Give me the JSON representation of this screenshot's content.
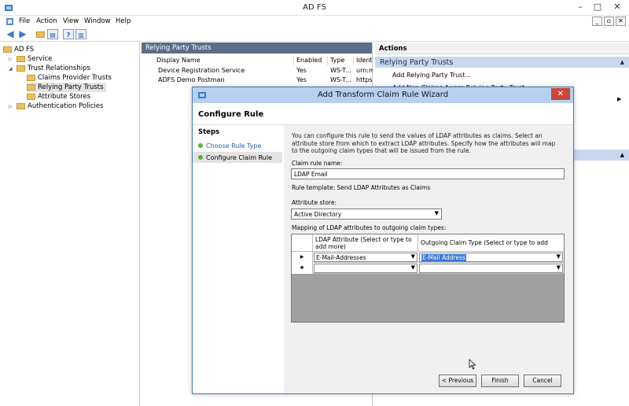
{
  "window": {
    "title": "AD FS",
    "controls": {
      "min": "–",
      "max": "□",
      "close": "✕"
    }
  },
  "menu": [
    "File",
    "Action",
    "View",
    "Window",
    "Help"
  ],
  "menu_sub_buttons": [
    "_",
    "▫",
    "✕"
  ],
  "tree": {
    "root": "AD FS",
    "items": [
      {
        "label": "Service"
      },
      {
        "label": "Trust Relationships"
      },
      {
        "label": "Claims Provider Trusts"
      },
      {
        "label": "Relying Party Trusts"
      },
      {
        "label": "Attribute Stores"
      },
      {
        "label": "Authentication Policies"
      }
    ]
  },
  "middle": {
    "header": "Relying Party Trusts",
    "columns": [
      "Display Name",
      "Enabled",
      "Type",
      "Identifi"
    ],
    "rows": [
      [
        "Device Registration Service",
        "Yes",
        "WS-T...",
        "urn:ms"
      ],
      [
        "ADFS Demo Postman",
        "Yes",
        "WS-T...",
        "https:/"
      ]
    ]
  },
  "actions": {
    "header": "Actions",
    "section": "Relying Party Trusts",
    "items": [
      "Add Relying Party Trust...",
      "Add Non-Claims-Aware Relying Party Trust..."
    ]
  },
  "dialog": {
    "title": "Add Transform Claim Rule Wizard",
    "heading": "Configure Rule",
    "steps_title": "Steps",
    "steps": [
      "Choose Rule Type",
      "Configure Claim Rule"
    ],
    "description": "You can configure this rule to send the values of LDAP attributes as claims. Select an attribute store from which to extract LDAP attributes. Specify how the attributes will map to the outgoing claim types that will be issued from the rule.",
    "claim_rule_name_label": "Claim rule name:",
    "claim_rule_name_value": "LDAP Email",
    "rule_template": "Rule template: Send LDAP Attributes as Claims",
    "attribute_store_label": "Attribute store:",
    "attribute_store_value": "Active Directory",
    "mapping_label": "Mapping of LDAP attributes to outgoing claim types:",
    "grid": {
      "col1": "LDAP Attribute (Select or type to add more)",
      "col2": "Outgoing Claim Type (Select or type to add more)",
      "rows": [
        {
          "marker": "▶",
          "ldap": "E-Mail-Addresses",
          "claim": "E-Mail Address"
        },
        {
          "marker": "✱",
          "ldap": "",
          "claim": ""
        }
      ]
    },
    "buttons": {
      "previous": "< Previous",
      "finish": "Finish",
      "cancel": "Cancel"
    }
  }
}
